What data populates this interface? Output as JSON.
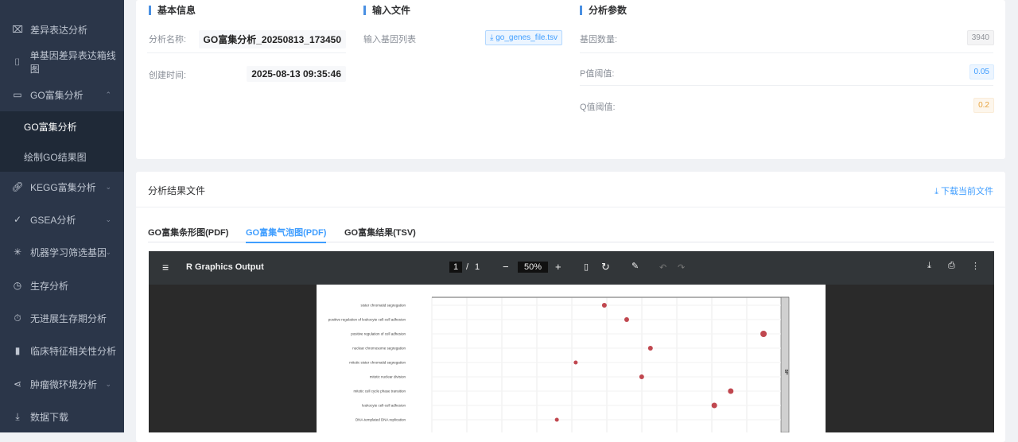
{
  "sidebar": {
    "items": [
      {
        "label": "差异表达分析",
        "icon": "chart-board-icon"
      },
      {
        "label": "单基因差异表达箱线图",
        "icon": "board-icon"
      },
      {
        "label": "GO富集分析",
        "icon": "box-icon",
        "expanded": true
      },
      {
        "label": "KEGG富集分析",
        "icon": "link-icon"
      },
      {
        "label": "GSEA分析",
        "icon": "check-icon"
      },
      {
        "label": "机器学习筛选基因",
        "icon": "sparkle-icon"
      },
      {
        "label": "生存分析",
        "icon": "clock-icon"
      },
      {
        "label": "无进展生存期分析",
        "icon": "timer-icon"
      },
      {
        "label": "临床特征相关性分析",
        "icon": "bar-chart-icon"
      },
      {
        "label": "肿瘤微环境分析",
        "icon": "share-icon"
      },
      {
        "label": "数据下载",
        "icon": "download-icon"
      }
    ],
    "sub": [
      {
        "label": "GO富集分析",
        "active": true
      },
      {
        "label": "绘制GO结果图"
      }
    ]
  },
  "basic": {
    "title": "基本信息",
    "name_label": "分析名称:",
    "name_value": "GO富集分析_20250813_173450",
    "time_label": "创建时间:",
    "time_value": "2025-08-13 09:35:46"
  },
  "input": {
    "title": "输入文件",
    "gene_list_label": "输入基因列表",
    "file": "go_genes_file.tsv"
  },
  "params": {
    "title": "分析参数",
    "gene_count_label": "基因数量:",
    "gene_count": "3940",
    "p_label": "P值阈值:",
    "p_value": "0.05",
    "q_label": "Q值阈值:",
    "q_value": "0.2"
  },
  "results": {
    "title": "分析结果文件",
    "download": "下载当前文件",
    "tabs": [
      "GO富集条形图(PDF)",
      "GO富集气泡图(PDF)",
      "GO富集结果(TSV)"
    ],
    "active_tab": 1
  },
  "viewer": {
    "title": "R Graphics Output",
    "page": "1",
    "pages": "1",
    "zoom": "50%"
  },
  "chart_data": {
    "type": "scatter",
    "facet": "BP",
    "xlim": [
      0,
      1
    ],
    "categories": [
      "sister chromatid segregation",
      "positive regulation of leukocyte cell-cell adhesion",
      "positive regulation of cell adhesion",
      "nuclear chromosome segregation",
      "mitotic sister chromatid segregation",
      "mitotic nuclear division",
      "mitotic cell cycle phase transition",
      "leukocyte cell-cell adhesion",
      "DNA-templated DNA replication"
    ],
    "x": [
      0.494,
      0.558,
      0.95,
      0.626,
      0.412,
      0.601,
      0.856,
      0.809,
      0.358
    ],
    "size": [
      3,
      3,
      4,
      3,
      2.5,
      3,
      3.5,
      3.5,
      2.5
    ],
    "color": "#c0474f"
  }
}
